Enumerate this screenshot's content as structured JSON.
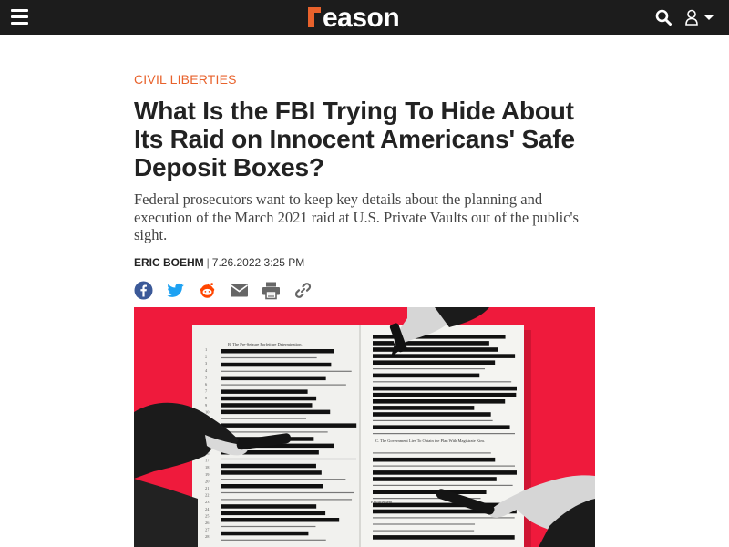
{
  "header": {
    "logo_text": "reason",
    "icons": {
      "menu": "hamburger-menu-icon",
      "search": "search-icon",
      "user": "user-icon"
    },
    "accent_color": "#e8622c",
    "bar_color": "#1c1c1c"
  },
  "article": {
    "category": "Civil Liberties",
    "headline": "What Is the FBI Trying To Hide About Its Raid on Innocent Americans' Safe Deposit Boxes?",
    "dek": "Federal prosecutors want to keep key details about the planning and execution of the March 2021 raid at U.S. Private Vaults out of the public's sight.",
    "author": "Eric Boehm",
    "separator": "|",
    "date": "7.26.2022 3:25 PM",
    "share_icons": [
      "facebook-icon",
      "twitter-icon",
      "reddit-icon",
      "email-icon",
      "print-icon",
      "link-icon"
    ],
    "hero": {
      "background_color": "#ef1a3c",
      "page_left": {
        "section_title": "B. The Pre-Seizure Forfeiture Determination.",
        "subsection": "C. The Government Lies To Obtain the Plan With Magistrate Kim."
      },
      "page_right": {
        "signature": "Enforcement"
      },
      "line_numbers": [
        "1",
        "2",
        "3",
        "4",
        "5",
        "6",
        "7",
        "8",
        "9",
        "10",
        "11",
        "12",
        "13",
        "14",
        "15",
        "16",
        "17",
        "18",
        "19",
        "20",
        "21",
        "22",
        "23",
        "24",
        "25",
        "26",
        "27",
        "28"
      ]
    }
  }
}
